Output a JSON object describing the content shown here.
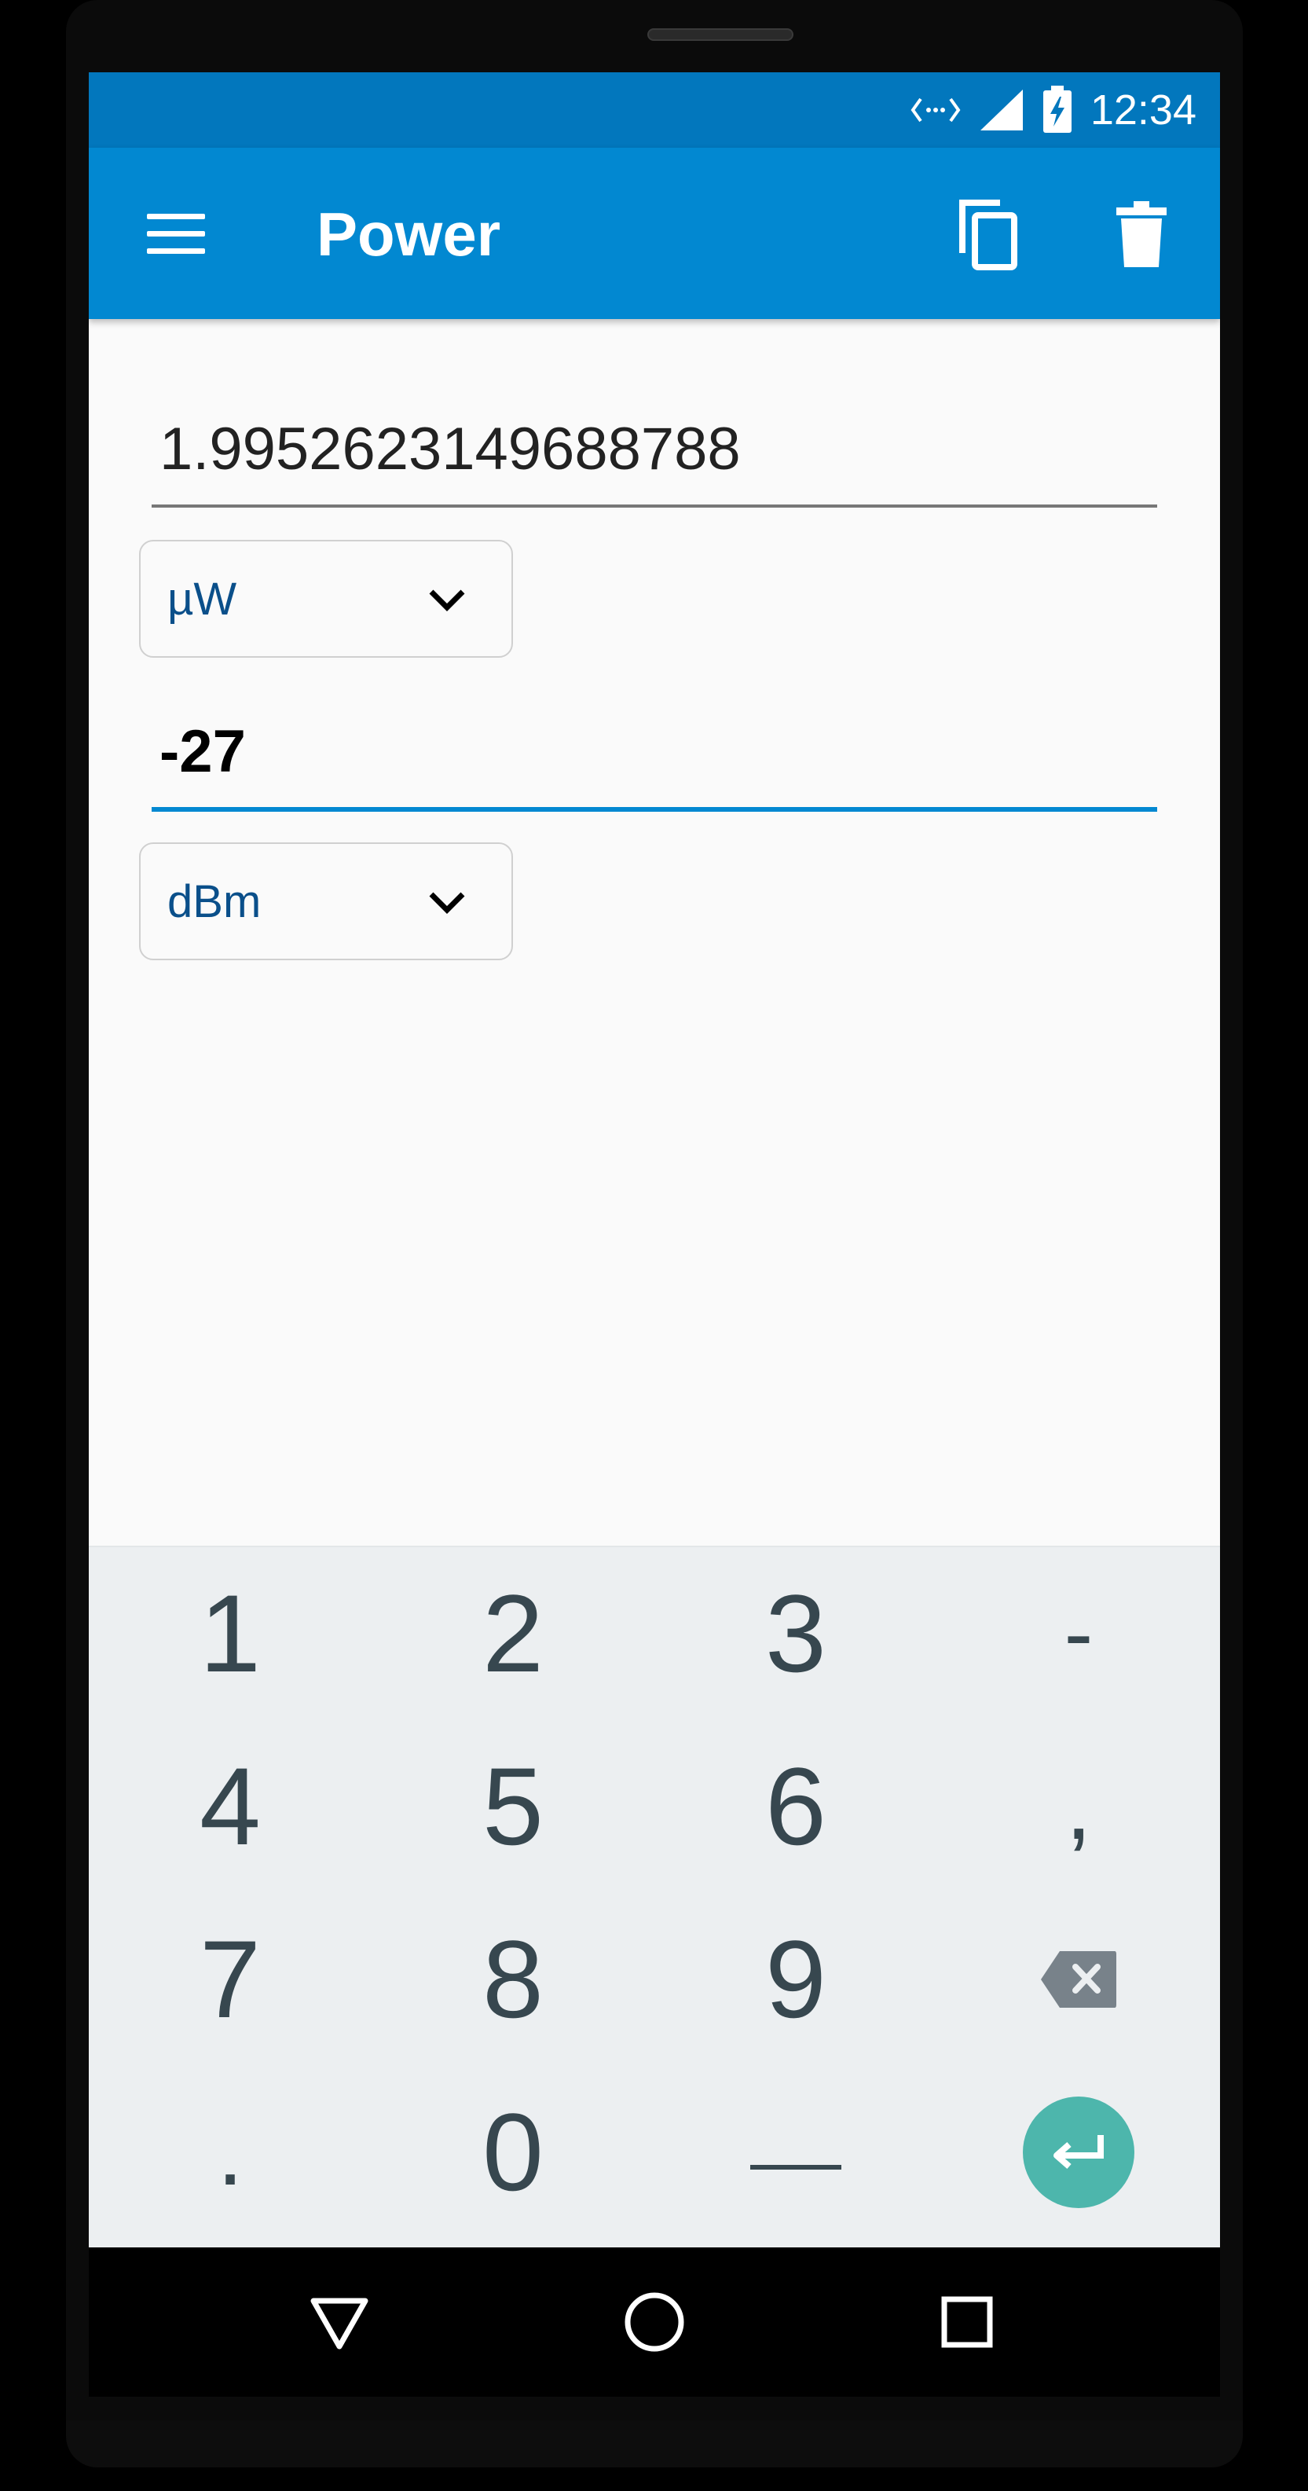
{
  "status_bar": {
    "time": "12:34",
    "icons": [
      "data-transfer-icon",
      "signal-icon",
      "battery-charging-icon"
    ]
  },
  "app_bar": {
    "title": "Power",
    "icons": [
      "menu-icon",
      "copy-icon",
      "delete-icon"
    ]
  },
  "converter": {
    "field1": {
      "value": "1.9952623149688788",
      "unit": "µW"
    },
    "field2": {
      "value": "-27",
      "unit": "dBm",
      "focused": true
    }
  },
  "keyboard": {
    "keys": [
      "1",
      "2",
      "3",
      "-",
      "4",
      "5",
      "6",
      ",",
      "7",
      "8",
      "9",
      "backspace-icon",
      ".",
      "0",
      "space",
      "enter-icon"
    ],
    "accent_color": "#4db6ac"
  },
  "colors": {
    "app_bar": "#0288d1",
    "status_bar": "#0277bd",
    "focus_line": "#0288d1",
    "unit_text": "#0a4f8a"
  },
  "nav_bar": {
    "icons": [
      "back-icon",
      "home-icon",
      "recents-icon"
    ]
  }
}
